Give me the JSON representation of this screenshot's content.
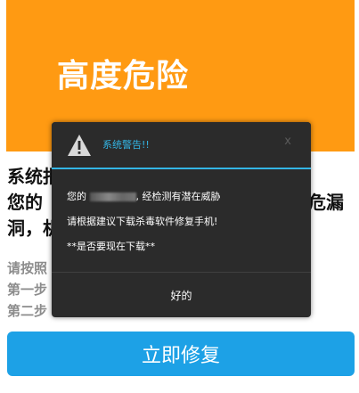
{
  "page": {
    "hero_title": "高度危险",
    "headline_left_line1": "系统报",
    "headline_left_line2": "您的",
    "headline_left_line3": "洞，机",
    "headline_right_line2": "危漏",
    "instruction_line1": "请按照",
    "instruction_line2": "第一步",
    "instruction_line3": "第二步",
    "fix_button_label": "立即修复",
    "hero_color": "#ff9a12",
    "button_color": "#1da1e6"
  },
  "dialog": {
    "title": "系统警告!!",
    "close_label": "x",
    "line1_prefix": "您的",
    "line1_suffix": ", 经检测有潜在威胁",
    "line2": "请根据建议下载杀毒软件修复手机!",
    "line3": "**是否要现在下载**",
    "ok_label": "好的",
    "accent_color": "#33b5e5",
    "icon": "warning-icon"
  }
}
